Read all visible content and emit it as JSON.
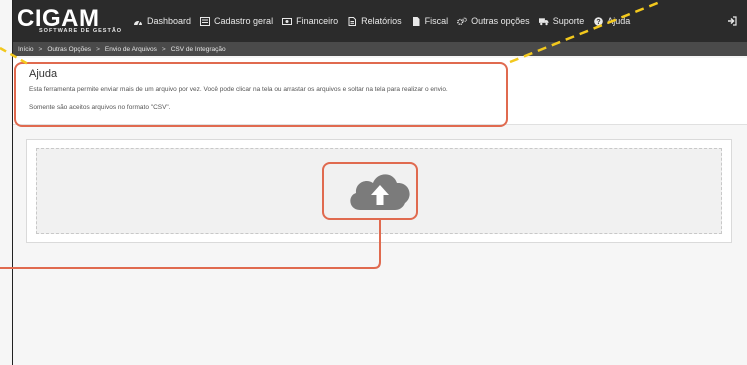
{
  "brand": {
    "logo_main": "CIGAM",
    "logo_sub": "SOFTWARE DE GESTÃO"
  },
  "nav": {
    "items": [
      {
        "label": "Dashboard",
        "icon": "dashboard-icon"
      },
      {
        "label": "Cadastro geral",
        "icon": "list-icon"
      },
      {
        "label": "Financeiro",
        "icon": "money-icon"
      },
      {
        "label": "Relatórios",
        "icon": "report-icon"
      },
      {
        "label": "Fiscal",
        "icon": "file-icon"
      },
      {
        "label": "Outras opções",
        "icon": "cogs-icon"
      },
      {
        "label": "Suporte",
        "icon": "truck-icon"
      },
      {
        "label": "Ajuda",
        "icon": "question-icon"
      }
    ],
    "logout_icon": "logout-icon"
  },
  "breadcrumb": [
    "Início",
    "Outras Opções",
    "Envio de Arquivos",
    "CSV de Integração"
  ],
  "help": {
    "title": "Ajuda",
    "text1": "Esta ferramenta permite enviar mais de um arquivo por vez. Você pode clicar na tela ou arrastar os arquivos e soltar na tela para realizar o envio.",
    "text2": "Somente são aceitos arquivos no formato \"CSV\"."
  },
  "upload": {
    "icon": "cloud-upload-icon"
  },
  "colors": {
    "navbar": "#2b2b2b",
    "breadcrumb_bar": "#4a4a4a",
    "highlight": "#e06a4f",
    "dashed_arrow": "#f2c81d"
  }
}
